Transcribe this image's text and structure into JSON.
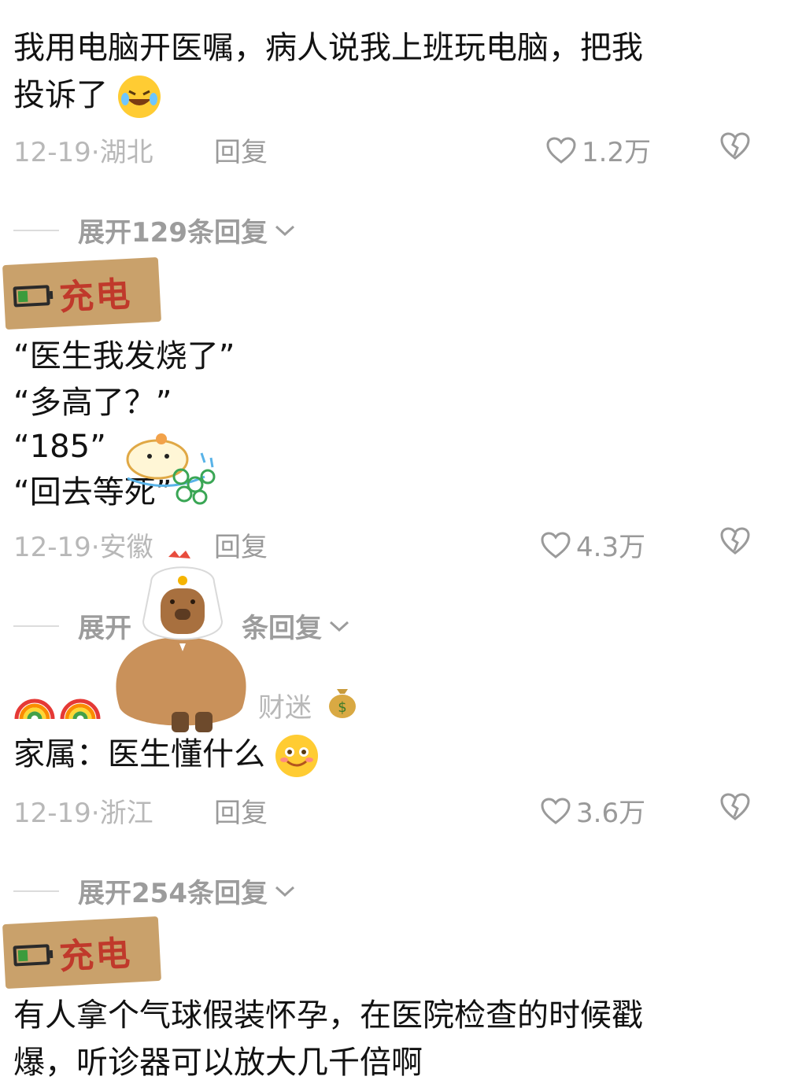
{
  "comments": [
    {
      "text_line1": "我用电脑开医嘱，病人说我上班玩电脑，把我",
      "text_line2": "投诉了",
      "date": "12-19",
      "location": "湖北",
      "reply_label": "回复",
      "likes": "1.2万",
      "expand_label": "展开129条回复"
    },
    {
      "badge": "充电",
      "lines": [
        "“医生我发烧了”",
        "“多高了？”",
        "“185”",
        "“回去等死”"
      ],
      "date": "12-19",
      "location": "安徽",
      "reply_label": "回复",
      "likes": "4.3万",
      "expand_label_start": "展开",
      "expand_label_end": "条回复"
    },
    {
      "username_suffix": "财迷",
      "text": "家属：医生懂什么",
      "date": "12-19",
      "location": "浙江",
      "reply_label": "回复",
      "likes": "3.6万",
      "expand_label": "展开254条回复"
    },
    {
      "badge": "充电",
      "text_line1": "有人拿个气球假装怀孕，在医院检查的时候戳",
      "text_line2": "爆，听诊器可以放大几千倍啊"
    }
  ],
  "icons": {
    "like": "heart-outline-icon",
    "dislike": "broken-heart-icon",
    "expand": "chevron-down-icon"
  },
  "colors": {
    "text": "#121212",
    "meta": "#b8b8b8",
    "action": "#9a9a9a",
    "badge_bg": "#c9a16b",
    "badge_text": "#c0392b"
  }
}
